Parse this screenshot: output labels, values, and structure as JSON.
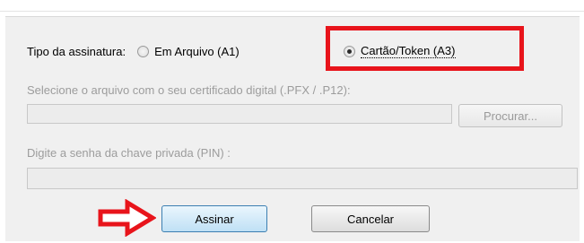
{
  "signature": {
    "label": "Tipo da assinatura:",
    "options": [
      {
        "label": "Em Arquivo (A1)",
        "selected": false
      },
      {
        "label": "Cartão/Token (A3)",
        "selected": true
      }
    ]
  },
  "certificate": {
    "caption": "Selecione o arquivo com o seu certificado digital (.PFX / .P12):",
    "value": "",
    "browse_label": "Procurar..."
  },
  "pin": {
    "caption": "Digite a senha da chave privada (PIN) :",
    "value": ""
  },
  "actions": {
    "sign_label": "Assinar",
    "cancel_label": "Cancelar"
  },
  "colors": {
    "highlight": "#e8141b",
    "arrow": "#e8141b"
  }
}
